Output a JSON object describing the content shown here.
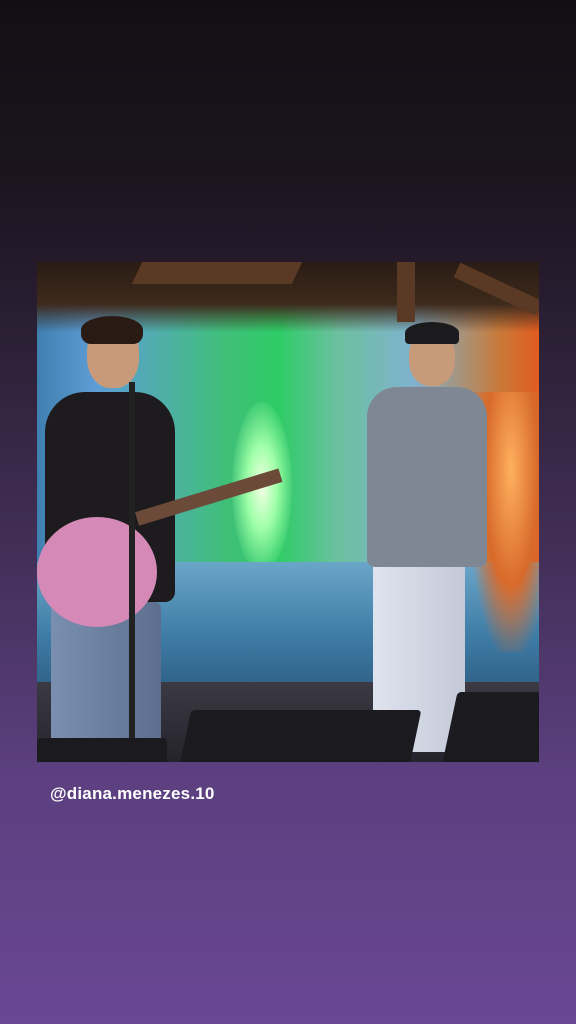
{
  "story": {
    "mention": "@diana.menezes.10",
    "photo_alt": "Two musicians performing on a stage"
  }
}
